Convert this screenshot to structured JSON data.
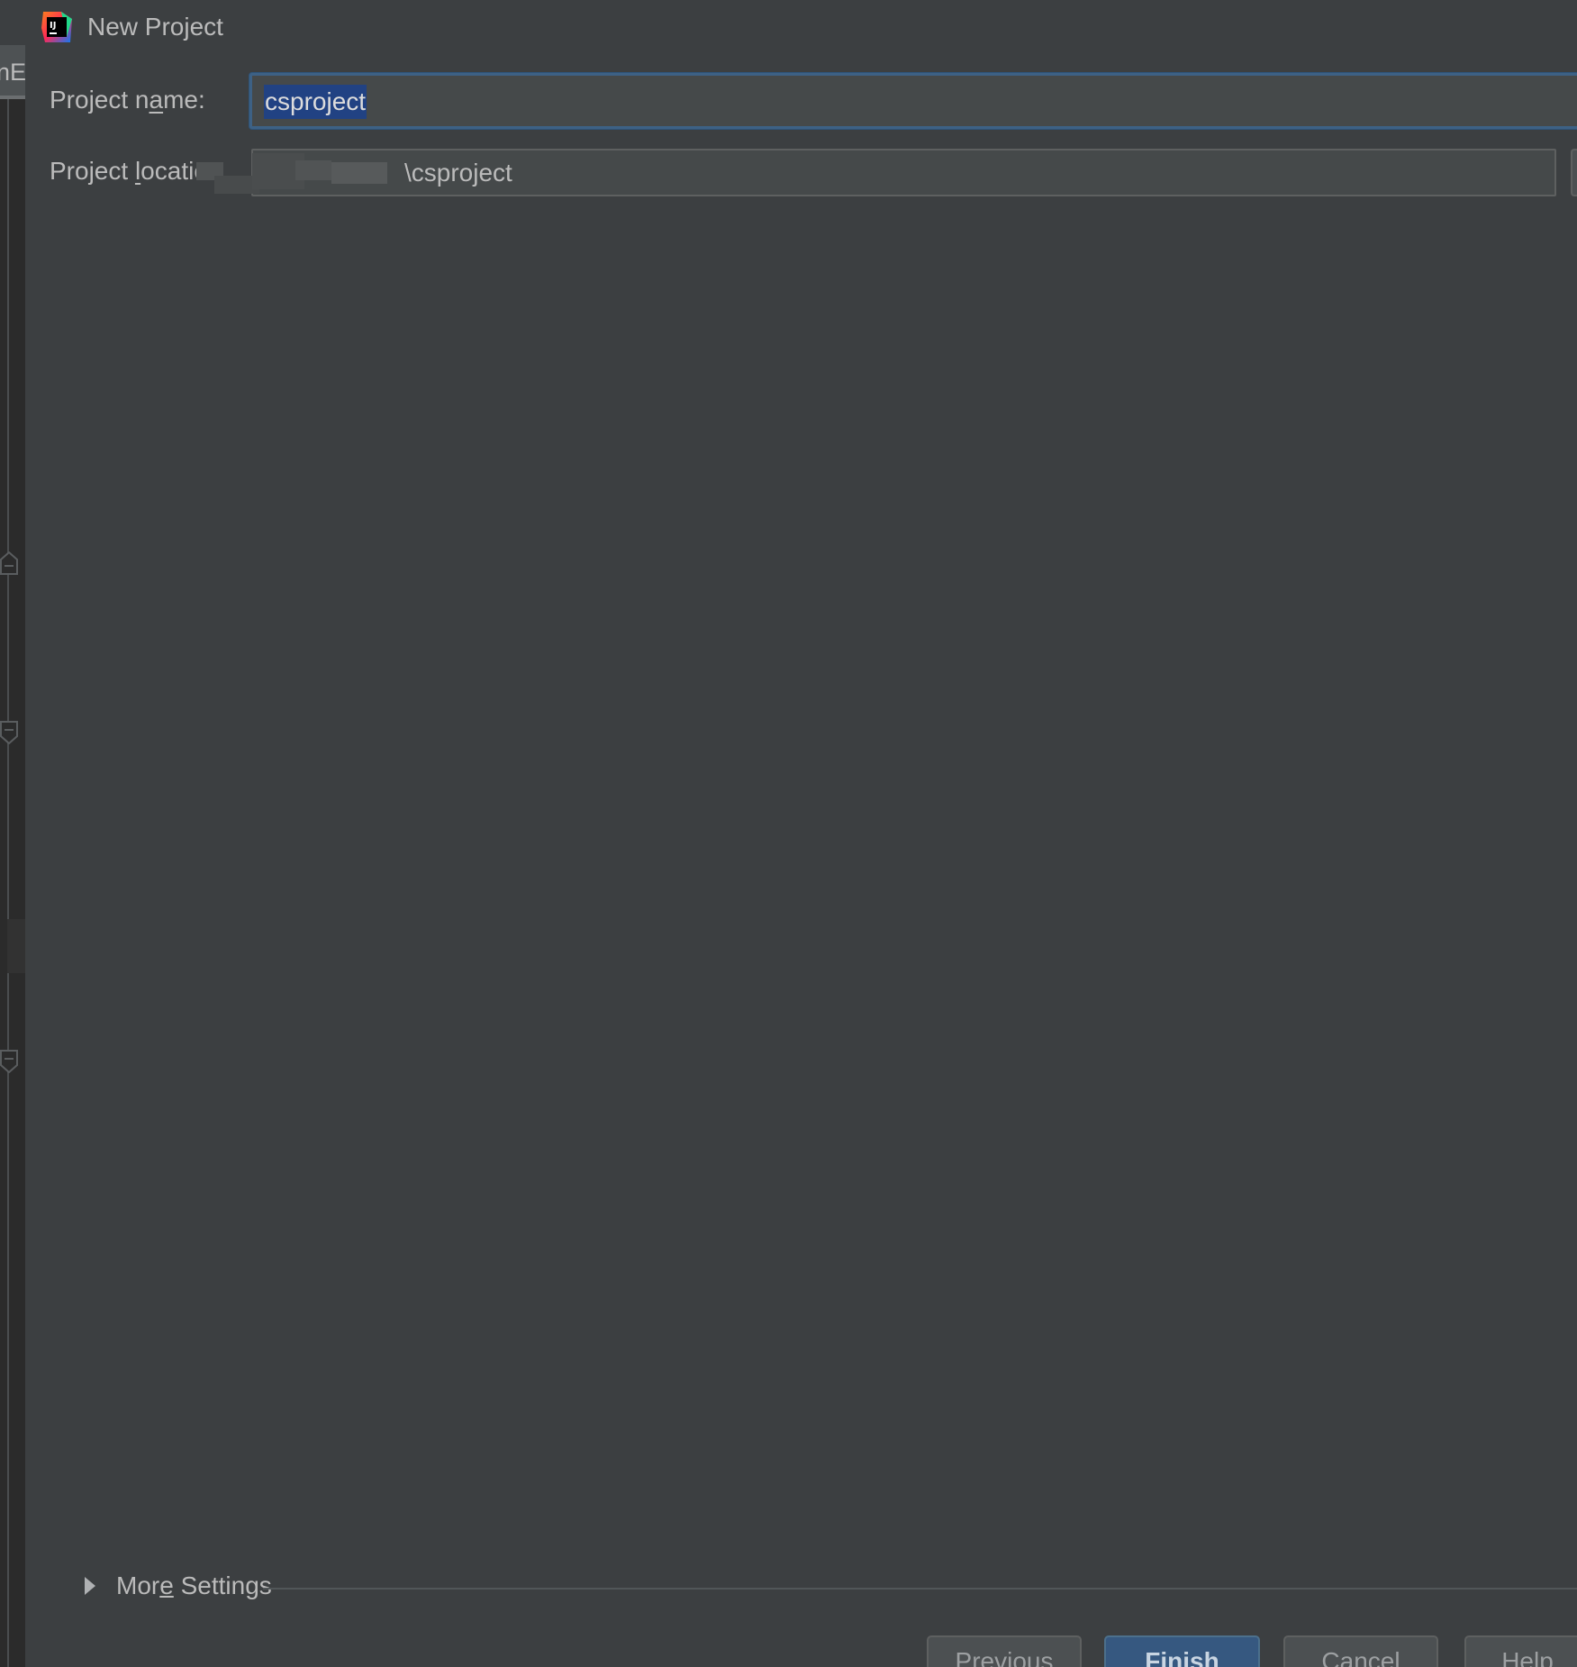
{
  "background_ide": {
    "tab_fragment": "nE"
  },
  "dialog": {
    "title": "New Project",
    "app_icon": "intellij-idea-icon",
    "fields": {
      "project_name": {
        "label_pre": "Project n",
        "label_mnemonic": "a",
        "label_post": "me:",
        "value": "csproject"
      },
      "project_location": {
        "label_pre": "Project ",
        "label_mnemonic": "l",
        "label_post": "ocatior",
        "value": "csproject",
        "value_prefix_visible": "\\"
      }
    },
    "more_settings": {
      "label_pre": "Mor",
      "label_mnemonic": "e",
      "label_post": " Settings",
      "icon": "triangle-right-icon"
    },
    "buttons": {
      "previous": "Previous",
      "finish": "Finish",
      "cancel": "Cancel",
      "help": "Help"
    }
  },
  "colors": {
    "dialog_bg": "#3c3f41",
    "field_bg": "#45494a",
    "focus_border": "#3d6185",
    "selection": "#214283",
    "primary_button": "#365880",
    "text": "#bbbbbb"
  }
}
